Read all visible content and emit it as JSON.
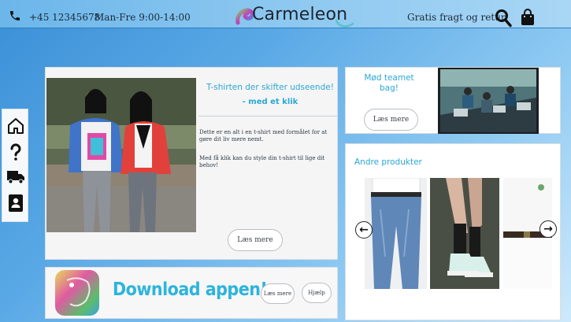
{
  "topbar": {
    "phone": "+45 12345678",
    "hours": "Man-Fre 9:00-14:00",
    "brand": "Carmeleon",
    "shipping": "Gratis fragt og retur",
    "icons": [
      "phone-icon",
      "search-icon",
      "bag-icon"
    ]
  },
  "sidenav": {
    "icons": [
      "home-icon",
      "help-icon",
      "truck-icon",
      "contact-icon"
    ]
  },
  "hero": {
    "title": "T-shirten der skifter udseende!",
    "subtitle": "- med et klik",
    "paragraph1": "Dette er en alt i en t-shirt med formålet for at gøre dit liv mere nemt.",
    "paragraph2": "Med få klik kan du style din t-shirt til lige dit behov!",
    "button": "Læs mere"
  },
  "download": {
    "headline": "Download appen!",
    "read_more": "Læs mere",
    "help": "Hjælp"
  },
  "team": {
    "text": "Mød teamet bag!",
    "button": "Læs mere"
  },
  "products": {
    "title": "Andre produkter",
    "prev_icon": "arrow-left-icon",
    "next_icon": "arrow-right-icon"
  },
  "colors": {
    "accent": "#2aa7d6",
    "background_start": "#3a8fd6",
    "background_end": "#cfe9fb"
  }
}
